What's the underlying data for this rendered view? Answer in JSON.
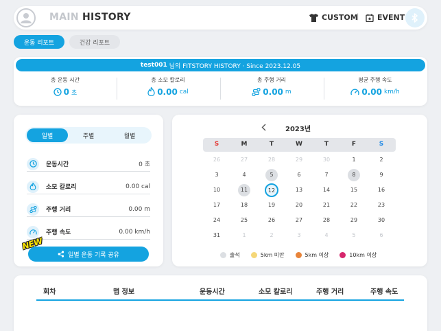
{
  "header": {
    "tab_main": "MAIN",
    "tab_history": "HISTORY",
    "custom_label": "CUSTOM",
    "event_label": "EVENT",
    "separator": "|"
  },
  "report_tabs": [
    "운동 리포트",
    "건강 리포트"
  ],
  "summary": {
    "user": "test001",
    "title_rest": "님의 FITSTORY HISTORY · Since 2023.12.05",
    "stats": [
      {
        "label": "총 운동 시간",
        "value": "0",
        "unit": "초",
        "icon": "clock-icon"
      },
      {
        "label": "총 소모 칼로리",
        "value": "0.00",
        "unit": "cal",
        "icon": "flame-icon"
      },
      {
        "label": "총 주행 거리",
        "value": "0.00",
        "unit": "m",
        "icon": "route-icon"
      },
      {
        "label": "평균 주행 속도",
        "value": "0.00",
        "unit": "km/h",
        "icon": "speedometer-icon"
      }
    ]
  },
  "period_tabs": [
    "일별",
    "주별",
    "월별"
  ],
  "metrics": [
    {
      "label": "운동시간",
      "value": "0 초",
      "icon": "clock-icon"
    },
    {
      "label": "소모 칼로리",
      "value": "0.00 cal",
      "icon": "flame-icon"
    },
    {
      "label": "주행 거리",
      "value": "0.00 m",
      "icon": "route-icon"
    },
    {
      "label": "주행 속도",
      "value": "0.00 km/h",
      "icon": "speedometer-icon"
    }
  ],
  "share": {
    "label": "일별 운동 기록 공유",
    "badge": "NEW"
  },
  "calendar": {
    "year_label": "2023년",
    "weekdays": [
      "S",
      "M",
      "T",
      "W",
      "T",
      "F",
      "S"
    ],
    "weeks": [
      [
        "26",
        "27",
        "28",
        "29",
        "30",
        "1",
        "2"
      ],
      [
        "3",
        "4",
        "5",
        "6",
        "7",
        "8",
        "9"
      ],
      [
        "10",
        "11",
        "12",
        "13",
        "14",
        "15",
        "16"
      ],
      [
        "17",
        "18",
        "19",
        "20",
        "21",
        "22",
        "23"
      ],
      [
        "24",
        "25",
        "26",
        "27",
        "28",
        "29",
        "30"
      ],
      [
        "31",
        "1",
        "2",
        "3",
        "4",
        "5",
        "6"
      ]
    ],
    "dim_cells": [
      [
        0,
        0
      ],
      [
        0,
        1
      ],
      [
        0,
        2
      ],
      [
        0,
        3
      ],
      [
        0,
        4
      ],
      [
        5,
        1
      ],
      [
        5,
        2
      ],
      [
        5,
        3
      ],
      [
        5,
        4
      ],
      [
        5,
        5
      ],
      [
        5,
        6
      ]
    ],
    "marked_cells": [
      [
        1,
        2
      ],
      [
        1,
        5
      ],
      [
        2,
        1
      ]
    ],
    "today_cell": [
      2,
      2
    ],
    "colors": {
      "accent": "#14a3e0",
      "sunday": "#e53935",
      "saturday": "#1e88e5"
    }
  },
  "legend": [
    {
      "label": "출석",
      "color": "#dcdfe3"
    },
    {
      "label": "5km 미만",
      "color": "#f5d778"
    },
    {
      "label": "5km 이상",
      "color": "#e8843a"
    },
    {
      "label": "10km 이상",
      "color": "#d6266c"
    }
  ],
  "table": {
    "columns": [
      "회차",
      "맵 정보",
      "운동시간",
      "소모 칼로리",
      "주행 거리",
      "주행 속도"
    ]
  }
}
